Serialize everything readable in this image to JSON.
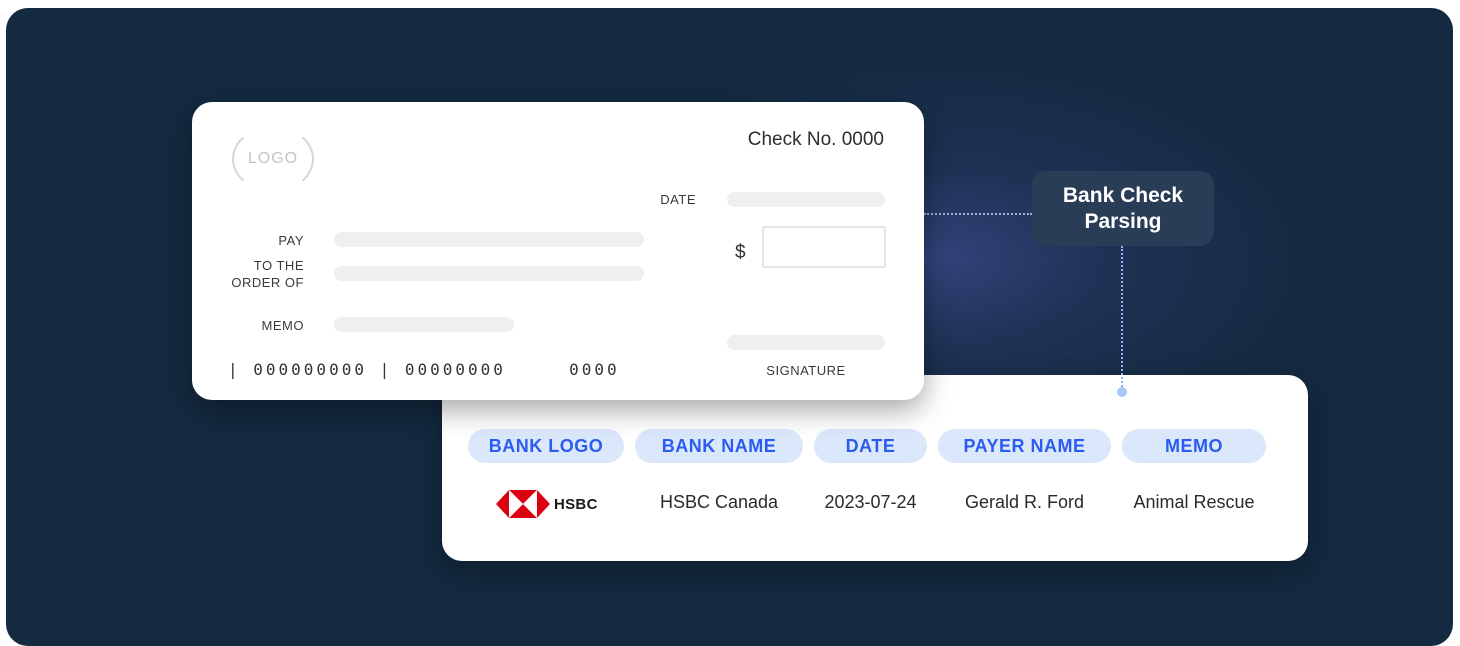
{
  "check": {
    "logo_text": "LOGO",
    "check_number": "Check No. 0000",
    "date_label": "DATE",
    "pay_label": "PAY",
    "to_order_line1": "TO THE",
    "to_order_line2": "ORDER OF",
    "dollar_sign": "$",
    "memo_label": "MEMO",
    "micr": "| 000000000 | 00000000     0000",
    "signature_label": "SIGNATURE"
  },
  "parsing_badge": {
    "line1": "Bank Check",
    "line2": "Parsing"
  },
  "results": {
    "headers": [
      "BANK LOGO",
      "BANK NAME",
      "DATE",
      "PAYER NAME",
      "MEMO"
    ],
    "bank_logo_text": "HSBC",
    "bank_name": "HSBC Canada",
    "date": "2023-07-24",
    "payer_name": "Gerald R. Ford",
    "memo": "Animal Rescue"
  },
  "colors": {
    "background": "#142a40",
    "accent": "#2b5cf0",
    "pill_bg": "#dbe7fb",
    "hsbc_red": "#db0011"
  }
}
